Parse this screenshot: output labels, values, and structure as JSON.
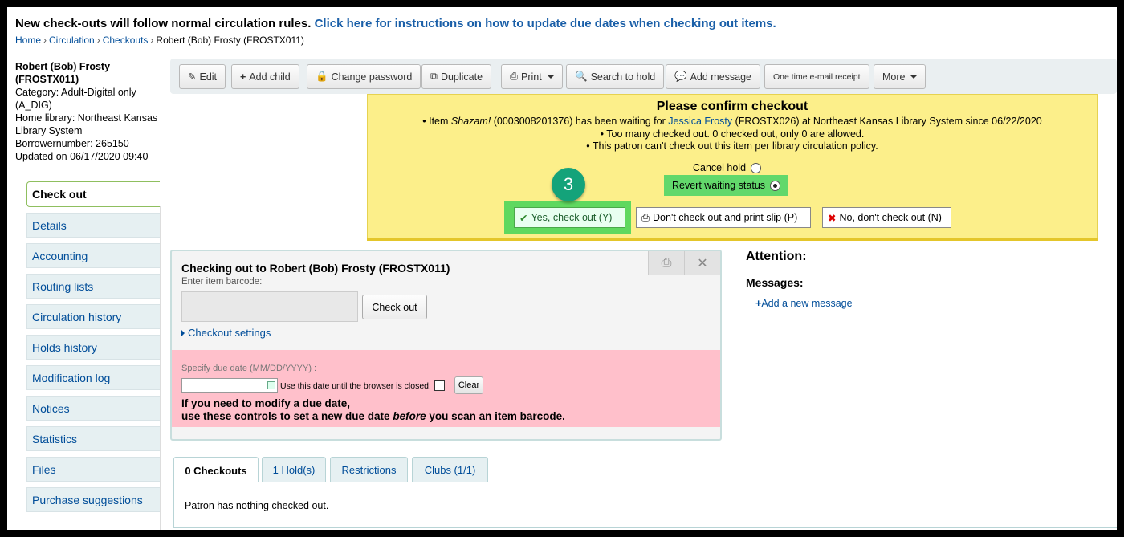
{
  "banner": {
    "text": "New check-outs will follow normal circulation rules.",
    "link": "Click here for instructions on how to update due dates when checking out items."
  },
  "breadcrumb": {
    "home": "Home",
    "circulation": "Circulation",
    "checkouts": "Checkouts",
    "current": "Robert (Bob) Frosty (FROSTX011)"
  },
  "patron": {
    "name": "Robert (Bob) Frosty (FROSTX011)",
    "category_line1": "Category: Adult-Digital only",
    "category_line2": "(A_DIG)",
    "home_library": "Home library: Northeast Kansas Library System",
    "borrowernumber": "Borrowernumber: 265150",
    "updated": "Updated on 06/17/2020 09:40"
  },
  "menu": {
    "checkout": "Check out",
    "details": "Details",
    "accounting": "Accounting",
    "routing": "Routing lists",
    "circ_history": "Circulation history",
    "holds_history": "Holds history",
    "modlog": "Modification log",
    "notices": "Notices",
    "statistics": "Statistics",
    "files": "Files",
    "suggestions": "Purchase suggestions"
  },
  "toolbar": {
    "edit": "Edit",
    "add_child": "Add child",
    "change_password": "Change password",
    "duplicate": "Duplicate",
    "print": "Print",
    "search_hold": "Search to hold",
    "add_message": "Add message",
    "email_receipt": "One time e-mail receipt",
    "more": "More"
  },
  "confirm": {
    "title": "Please confirm checkout",
    "item_pre": "Item ",
    "item_title": "Shazam!",
    "item_mid": " (0003008201376) has been waiting for ",
    "item_patron": "Jessica Frosty",
    "item_post": " (FROSTX026) at Northeast Kansas Library System since 06/22/2020",
    "too_many": "Too many checked out. 0 checked out, only 0 are allowed.",
    "policy": "This patron can't check out this item per library circulation policy.",
    "cancel_hold": "Cancel hold",
    "revert": "Revert waiting status",
    "yes": "Yes, check out (Y)",
    "dont_print": "Don't check out and print slip (P)",
    "no": "No, don't check out (N)"
  },
  "step_badge": "3",
  "checkout_panel": {
    "header": "Checking out to Robert (Bob) Frosty (FROSTX011)",
    "barcode_label": "Enter item barcode:",
    "checkout_button": "Check out",
    "settings": "Checkout settings",
    "due_label": "Specify due date (MM/DD/YYYY) :",
    "use_date": "Use this date until the browser is closed:",
    "clear": "Clear",
    "warn1": "If you need to modify a due date,",
    "warn2_pre": "use these controls to set a new due date ",
    "warn2_em": "before",
    "warn2_post": " you scan an item barcode."
  },
  "attention": {
    "title": "Attention:",
    "messages": "Messages:",
    "add_message": "Add a new message"
  },
  "tabs": {
    "checkouts": "0 Checkouts",
    "holds": "1 Hold(s)",
    "restrictions": "Restrictions",
    "clubs": "Clubs (1/1)",
    "panel_text": "Patron has nothing checked out."
  },
  "colors": {
    "highlight_green": "#62d86b",
    "confirm_yellow": "#fcef8a",
    "due_pink": "#ffc0cb",
    "badge": "#14a37a"
  }
}
